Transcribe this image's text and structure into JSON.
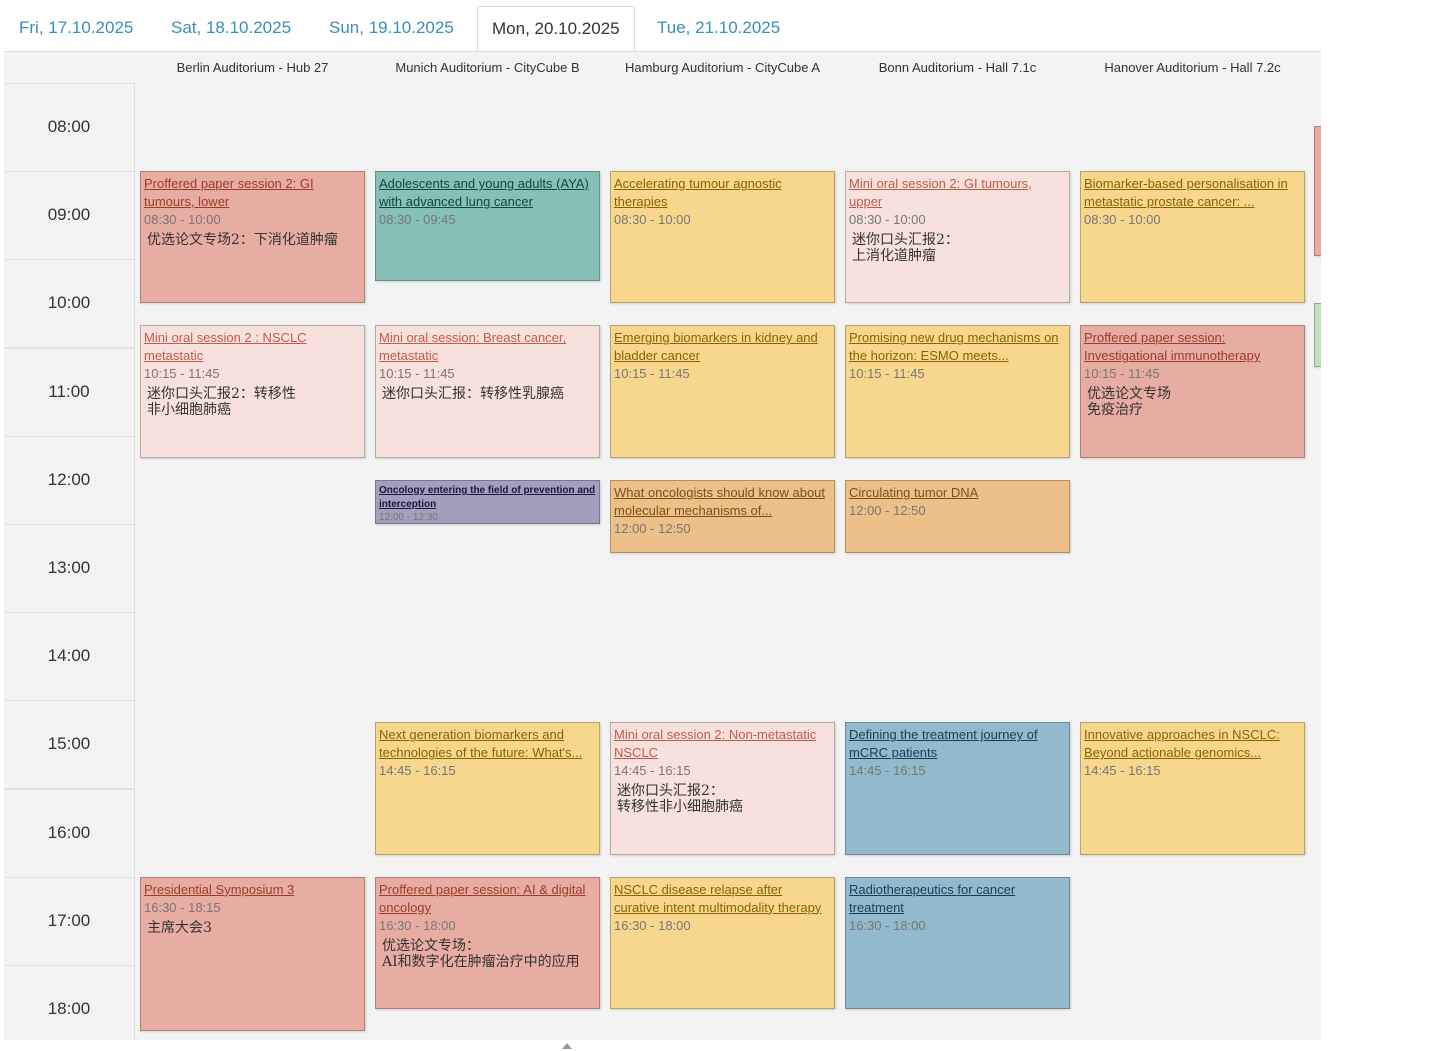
{
  "tabs": [
    {
      "label": "Fri, 17.10.2025",
      "active": false
    },
    {
      "label": "Sat, 18.10.2025",
      "active": false
    },
    {
      "label": "Sun, 19.10.2025",
      "active": false
    },
    {
      "label": "Mon, 20.10.2025",
      "active": true
    },
    {
      "label": "Tue, 21.10.2025",
      "active": false
    }
  ],
  "rooms": [
    "Berlin Auditorium - Hub 27",
    "Munich Auditorium - CityCube B",
    "Hamburg Auditorium - CityCube A",
    "Bonn Auditorium - Hall 7.1c",
    "Hanover Auditorium - Hall 7.2c"
  ],
  "hours": [
    "08:00",
    "09:00",
    "10:00",
    "11:00",
    "12:00",
    "13:00",
    "14:00",
    "15:00",
    "16:00",
    "17:00",
    "18:00"
  ],
  "events": [
    {
      "room": 0,
      "start": "08:30",
      "end": "10:00",
      "title": "Proffered paper session 2: GI tumours, lower",
      "time": "08:30 - 10:00",
      "subtitle": "优选论文专场2：下消化道肿瘤",
      "color": "red"
    },
    {
      "room": 1,
      "start": "08:30",
      "end": "09:45",
      "title": "Adolescents and young adults (AYA) with advanced lung cancer",
      "time": "08:30 - 09:45",
      "subtitle": "",
      "color": "teal"
    },
    {
      "room": 2,
      "start": "08:30",
      "end": "10:00",
      "title": "Accelerating tumour agnostic therapies",
      "time": "08:30 - 10:00",
      "subtitle": "",
      "color": "yellow"
    },
    {
      "room": 3,
      "start": "08:30",
      "end": "10:00",
      "title": "Mini oral session 2: GI tumours, upper",
      "time": "08:30 - 10:00",
      "subtitle": "迷你口头汇报2：\n上消化道肿瘤",
      "color": "pink"
    },
    {
      "room": 4,
      "start": "08:30",
      "end": "10:00",
      "title": "Biomarker-based personalisation in metastatic prostate cancer: ...",
      "time": "08:30 - 10:00",
      "subtitle": "",
      "color": "yellow"
    },
    {
      "room": 0,
      "start": "10:15",
      "end": "11:45",
      "title": "Mini oral session 2 : NSCLC metastatic",
      "time": "10:15 - 11:45",
      "subtitle": "迷你口头汇报2：转移性\n非小细胞肺癌",
      "color": "pink"
    },
    {
      "room": 1,
      "start": "10:15",
      "end": "11:45",
      "title": "Mini oral session: Breast cancer, metastatic",
      "time": "10:15 - 11:45",
      "subtitle": "迷你口头汇报：转移性乳腺癌",
      "color": "pink"
    },
    {
      "room": 2,
      "start": "10:15",
      "end": "11:45",
      "title": "Emerging biomarkers in kidney and bladder cancer",
      "time": "10:15 - 11:45",
      "subtitle": "",
      "color": "yellow"
    },
    {
      "room": 3,
      "start": "10:15",
      "end": "11:45",
      "title": "Promising new drug mechanisms on the horizon: ESMO meets...",
      "time": "10:15 - 11:45",
      "subtitle": "",
      "color": "yellow"
    },
    {
      "room": 4,
      "start": "10:15",
      "end": "11:45",
      "title": "Proffered paper session: Investigational immunotherapy",
      "time": "10:15 - 11:45",
      "subtitle": "优选论文专场\n免疫治疗",
      "color": "red"
    },
    {
      "room": 1,
      "start": "12:00",
      "end": "12:30",
      "title": "Oncology entering the field of prevention and interception",
      "time": "12:00 - 12:30",
      "subtitle": "",
      "color": "purple"
    },
    {
      "room": 2,
      "start": "12:00",
      "end": "12:50",
      "title": "What oncologists should know about molecular mechanisms of...",
      "time": "12:00 - 12:50",
      "subtitle": "",
      "color": "orange"
    },
    {
      "room": 3,
      "start": "12:00",
      "end": "12:50",
      "title": "Circulating tumor DNA",
      "time": "12:00 - 12:50",
      "subtitle": "",
      "color": "orange"
    },
    {
      "room": 1,
      "start": "14:45",
      "end": "16:15",
      "title": "Next generation biomarkers and technologies of the future: What's...",
      "time": "14:45 - 16:15",
      "subtitle": "",
      "color": "yellow"
    },
    {
      "room": 2,
      "start": "14:45",
      "end": "16:15",
      "title": "Mini oral session 2: Non-metastatic NSCLC",
      "time": "14:45 - 16:15",
      "subtitle": "迷你口头汇报2：\n转移性非小细胞肺癌",
      "color": "pink"
    },
    {
      "room": 3,
      "start": "14:45",
      "end": "16:15",
      "title": "Defining the treatment journey of mCRC patients",
      "time": "14:45 - 16:15",
      "subtitle": "",
      "color": "blue"
    },
    {
      "room": 4,
      "start": "14:45",
      "end": "16:15",
      "title": "Innovative approaches in NSCLC: Beyond actionable genomics...",
      "time": "14:45 - 16:15",
      "subtitle": "",
      "color": "yellow"
    },
    {
      "room": 0,
      "start": "16:30",
      "end": "18:15",
      "title": "Presidential Symposium 3",
      "time": "16:30 - 18:15",
      "subtitle": "主席大会3",
      "color": "red"
    },
    {
      "room": 1,
      "start": "16:30",
      "end": "18:00",
      "title": "Proffered paper session: AI & digital oncology",
      "time": "16:30 - 18:00",
      "subtitle": "优选论文专场：\nAI和数字化在肿瘤治疗中的应用",
      "color": "red"
    },
    {
      "room": 2,
      "start": "16:30",
      "end": "18:00",
      "title": "NSCLC disease relapse after curative intent multimodality therapy",
      "time": "16:30 - 18:00",
      "subtitle": "",
      "color": "yellow"
    },
    {
      "room": 3,
      "start": "16:30",
      "end": "18:00",
      "title": "Radiotherapeutics for cancer treatment",
      "time": "16:30 - 18:00",
      "subtitle": "",
      "color": "blue"
    }
  ]
}
